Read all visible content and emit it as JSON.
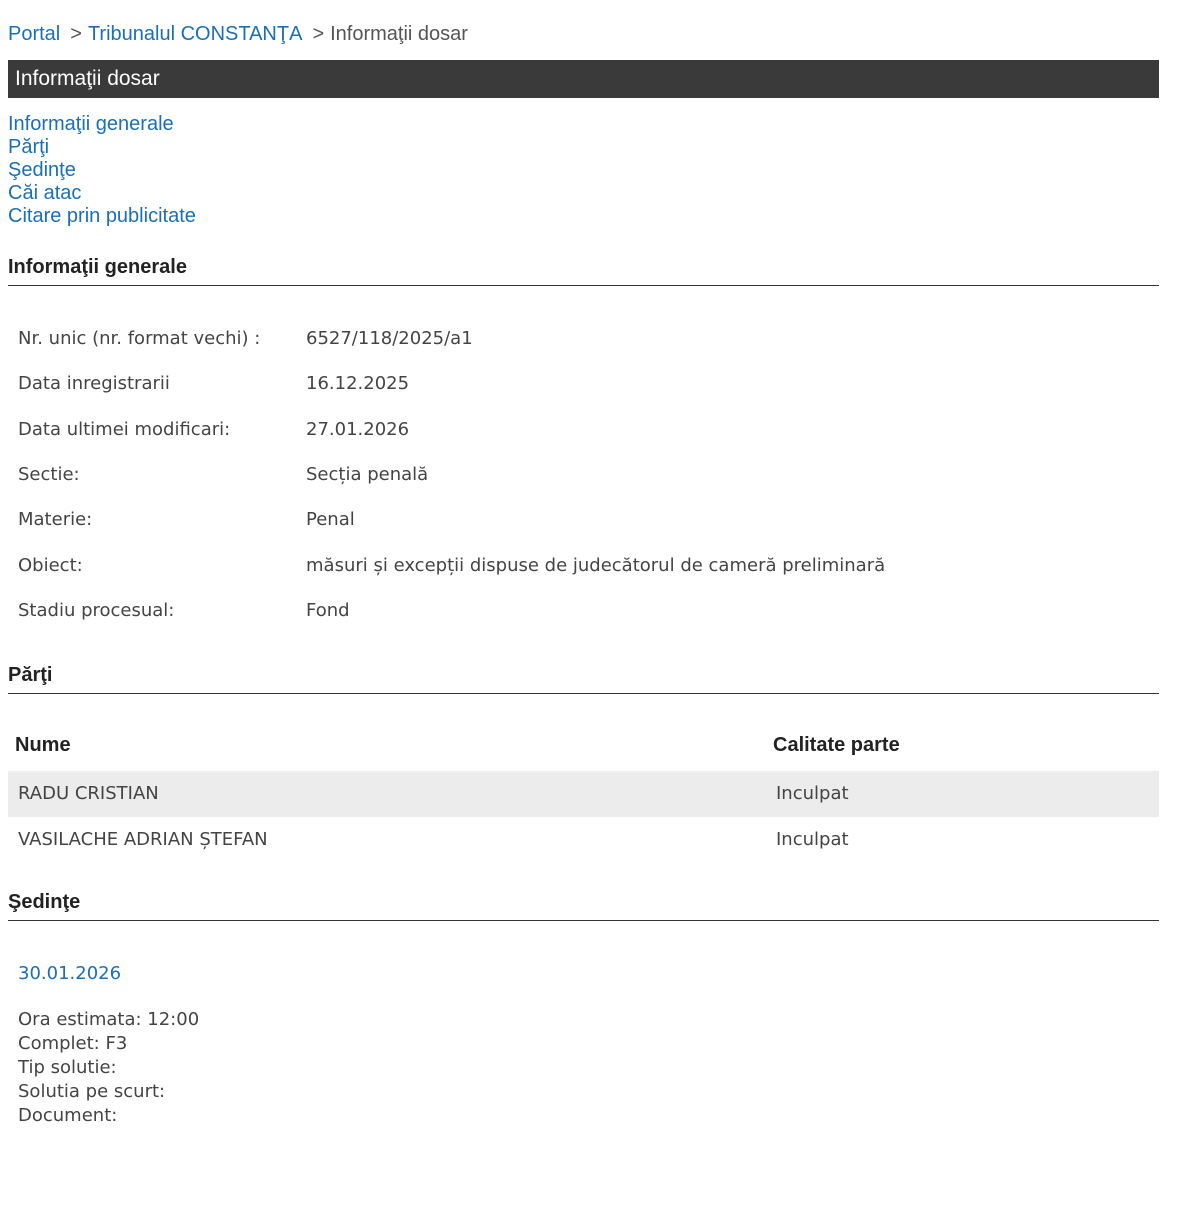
{
  "breadcrumb": {
    "portal": "Portal",
    "sep1": ">",
    "court": "Tribunalul CONSTANŢA",
    "sep2": ">",
    "current": "Informaţii dosar"
  },
  "title": "Informaţii dosar",
  "nav": {
    "items": [
      {
        "label": "Informaţii generale"
      },
      {
        "label": "Părţi"
      },
      {
        "label": "Şedinţe"
      },
      {
        "label": "Căi atac"
      },
      {
        "label": "Citare prin publicitate"
      }
    ]
  },
  "general": {
    "heading": "Informaţii generale",
    "rows": [
      {
        "label": "Nr. unic (nr. format vechi) :",
        "value": "6527/118/2025/a1"
      },
      {
        "label": "Data inregistrarii",
        "value": "16.12.2025"
      },
      {
        "label": "Data ultimei modificari:",
        "value": "27.01.2026"
      },
      {
        "label": "Sectie:",
        "value": "Secția penală"
      },
      {
        "label": "Materie:",
        "value": "Penal"
      },
      {
        "label": "Obiect:",
        "value": "măsuri și excepții dispuse de judecătorul de cameră preliminară"
      },
      {
        "label": "Stadiu procesual:",
        "value": "Fond"
      }
    ]
  },
  "parti": {
    "heading": "Părţi",
    "col_name": "Nume",
    "col_role": "Calitate parte",
    "rows": [
      {
        "name": "RADU CRISTIAN",
        "role": "Inculpat"
      },
      {
        "name": "VASILACHE ADRIAN ȘTEFAN",
        "role": "Inculpat"
      }
    ]
  },
  "sedinte": {
    "heading": "Şedinţe",
    "date": "30.01.2026",
    "lines": [
      "Ora estimata: 12:00",
      "Complet: F3",
      "Tip solutie:",
      "Solutia pe scurt:",
      "Document:"
    ]
  }
}
